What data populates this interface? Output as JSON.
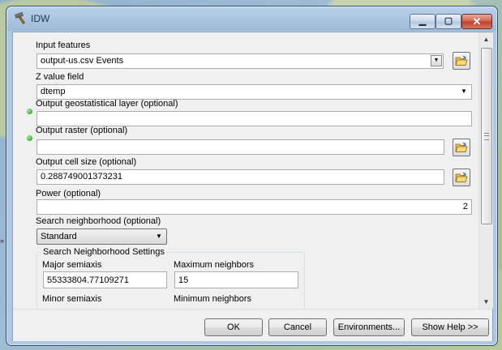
{
  "window": {
    "title": "IDW"
  },
  "fields": {
    "input_features": {
      "label": "Input features",
      "value": "output-us.csv Events"
    },
    "z_value_field": {
      "label": "Z value field",
      "value": "dtemp"
    },
    "output_geo_layer": {
      "label": "Output geostatistical layer (optional)",
      "value": ""
    },
    "output_raster": {
      "label": "Output raster (optional)",
      "value": ""
    },
    "output_cell_size": {
      "label": "Output cell size (optional)",
      "value": "0.288749001373231"
    },
    "power": {
      "label": "Power (optional)",
      "value": "2"
    },
    "search_neighborhood": {
      "label": "Search neighborhood (optional)",
      "value": "Standard"
    }
  },
  "search_settings": {
    "title": "Search Neighborhood Settings",
    "major_semiaxis": {
      "label": "Major semiaxis",
      "value": "55333804.77109271"
    },
    "maximum_neighbors": {
      "label": "Maximum neighbors",
      "value": "15"
    },
    "minor_semiaxis": {
      "label": "Minor semiaxis"
    },
    "minimum_neighbors": {
      "label": "Minimum neighbors"
    }
  },
  "buttons": {
    "ok": "OK",
    "cancel": "Cancel",
    "environments": "Environments...",
    "show_help": "Show Help >>"
  },
  "icons": [
    "hammer-icon",
    "minimize-icon",
    "maximize-icon",
    "close-icon",
    "folder-open-icon",
    "required-dot-icon"
  ]
}
